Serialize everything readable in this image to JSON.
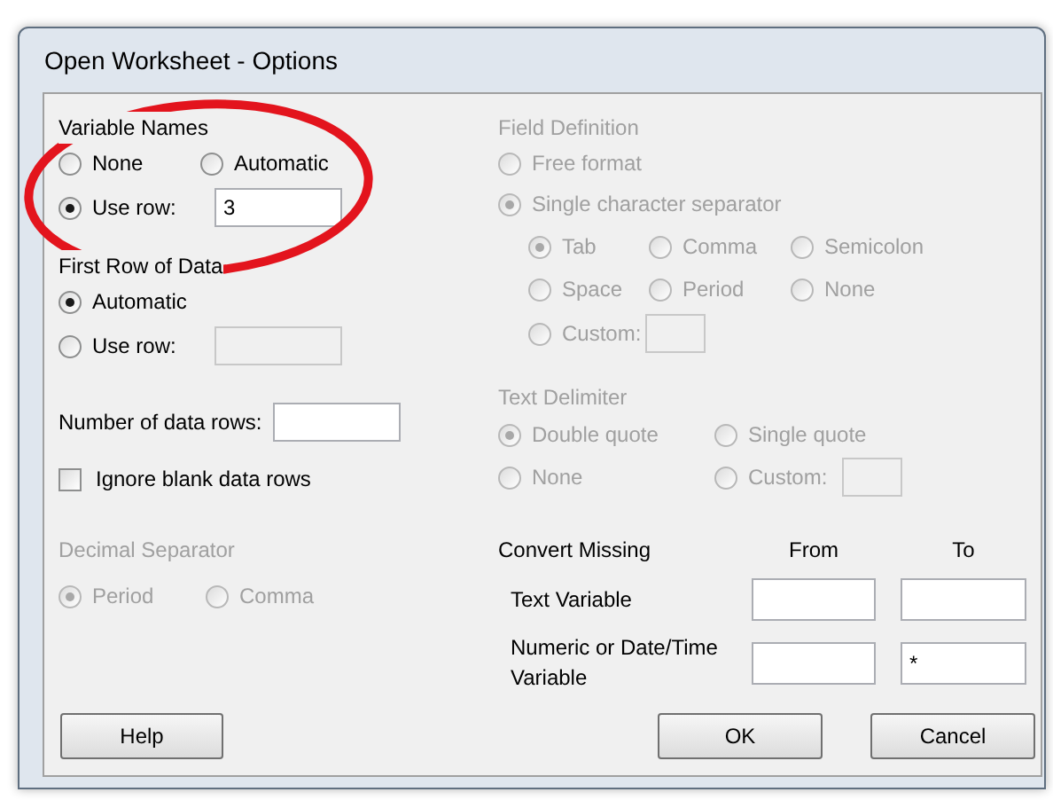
{
  "window": {
    "title": "Open Worksheet - Options"
  },
  "variable_names": {
    "title": "Variable Names",
    "use_row_value": "3",
    "options": [
      {
        "label": "None",
        "selected": false
      },
      {
        "label": "Automatic",
        "selected": false
      },
      {
        "label": "Use row:",
        "selected": true
      }
    ]
  },
  "first_row_of_data": {
    "title": "First Row of Data",
    "use_row_disabled": true,
    "options": [
      {
        "label": "Automatic",
        "selected": true
      },
      {
        "label": "Use row:",
        "selected": false
      }
    ]
  },
  "number_of_data_rows": {
    "label": "Number of data rows:"
  },
  "ignore_blank_rows": {
    "label": "Ignore blank data rows",
    "checked": false
  },
  "decimal_separator": {
    "title": "Decimal Separator",
    "disabled": true,
    "options": [
      {
        "label": "Period",
        "selected": true
      },
      {
        "label": "Comma",
        "selected": false
      }
    ]
  },
  "field_definition": {
    "title": "Field Definition",
    "disabled": true,
    "options": [
      {
        "label": "Free format",
        "selected": false
      },
      {
        "label": "Single character separator",
        "selected": true
      }
    ],
    "separators": [
      {
        "kind": "radio",
        "label": "Tab",
        "selected": true
      },
      {
        "kind": "radio",
        "label": "Comma",
        "selected": false
      },
      {
        "kind": "radio",
        "label": "Semicolon",
        "selected": false
      },
      {
        "kind": "radio",
        "label": "Space",
        "selected": false
      },
      {
        "kind": "radio",
        "label": "Period",
        "selected": false
      },
      {
        "kind": "radio",
        "label": "None",
        "selected": false
      },
      {
        "kind": "field",
        "label": "Custom:",
        "selected": false
      }
    ]
  },
  "text_delimiter": {
    "title": "Text Delimiter",
    "disabled": true,
    "options": [
      {
        "kind": "radio",
        "label": "Double quote",
        "selected": true
      },
      {
        "kind": "radio",
        "label": "Single quote",
        "selected": false
      },
      {
        "kind": "radio",
        "label": "None",
        "selected": false
      },
      {
        "kind": "field",
        "label": "Custom:",
        "selected": false
      }
    ]
  },
  "convert_missing": {
    "title": "Convert Missing",
    "columns": [
      "From",
      "To"
    ],
    "rows": [
      {
        "label": "Text Variable"
      },
      {
        "label": "Numeric or Date/Time Variable",
        "to": "*"
      }
    ]
  },
  "buttons": [
    "Help",
    "OK",
    "Cancel"
  ]
}
